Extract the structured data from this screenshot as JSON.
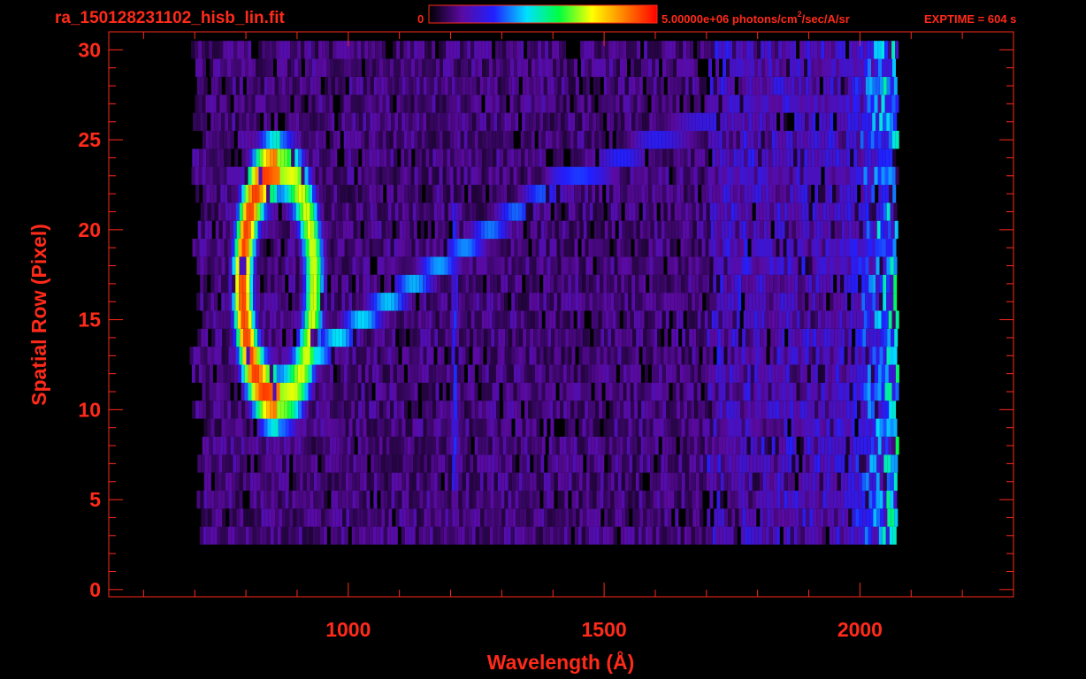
{
  "header": {
    "filename": "ra_150128231102_hisb_lin.fit",
    "colorbar_min": "0",
    "colorbar_max_prefix": "5.00000e+06 photons/cm",
    "colorbar_max_sup": "2",
    "colorbar_max_suffix": "/sec/A/sr",
    "exptime": "EXPTIME = 604 s"
  },
  "colors": {
    "axis": "#ff2a1a",
    "background": "#000000",
    "colormap": [
      "#000000",
      "#5a0aa0",
      "#2020ff",
      "#00e0ff",
      "#00ff40",
      "#ffff00",
      "#ff8000",
      "#ff0000"
    ]
  },
  "chart_data": {
    "type": "heatmap",
    "title": "",
    "xlabel": "Wavelength (Å)",
    "ylabel": "Spatial Row (Pixel)",
    "xlim": [
      532,
      2300
    ],
    "ylim": [
      -0.4,
      31
    ],
    "x_ticks": [
      1000,
      1500,
      2000
    ],
    "x_tick_labels": [
      "1000",
      "1500",
      "2000"
    ],
    "y_ticks": [
      0,
      5,
      10,
      15,
      20,
      25,
      30
    ],
    "y_tick_labels": [
      "0",
      "5",
      "10",
      "15",
      "20",
      "25",
      "30"
    ],
    "grid": false,
    "colorbar": {
      "min": 0,
      "max": 5000000,
      "units": "photons/cm^2/sec/A/sr"
    },
    "rows": {
      "min": 0,
      "max": 30
    },
    "features": [
      {
        "name_visible": false,
        "kind": "ring",
        "center_x": 860,
        "center_row": 17,
        "x_radius": 70,
        "row_radius": 6.5,
        "intensity": 0.85
      },
      {
        "name_visible": false,
        "kind": "diagonal_band",
        "points": [
          [
            930,
            13
          ],
          [
            1000,
            14.5
          ],
          [
            1100,
            16.5
          ],
          [
            1200,
            18.5
          ],
          [
            1300,
            20.5
          ],
          [
            1400,
            22.5
          ],
          [
            1500,
            23.5
          ],
          [
            1600,
            25
          ],
          [
            1700,
            26
          ],
          [
            1800,
            27.5
          ]
        ],
        "intensity": 0.45
      },
      {
        "name_visible": false,
        "kind": "vertical_line",
        "x": 1205,
        "row_from": 6,
        "row_to": 22,
        "intensity": 0.3
      },
      {
        "name_visible": false,
        "kind": "edge_brightening",
        "x_from": 1900,
        "x_to": 2070,
        "intensity": 0.45
      }
    ],
    "data_extent": {
      "x_min": 700,
      "x_max": 2070,
      "row_min": 3,
      "row_max": 30
    }
  }
}
